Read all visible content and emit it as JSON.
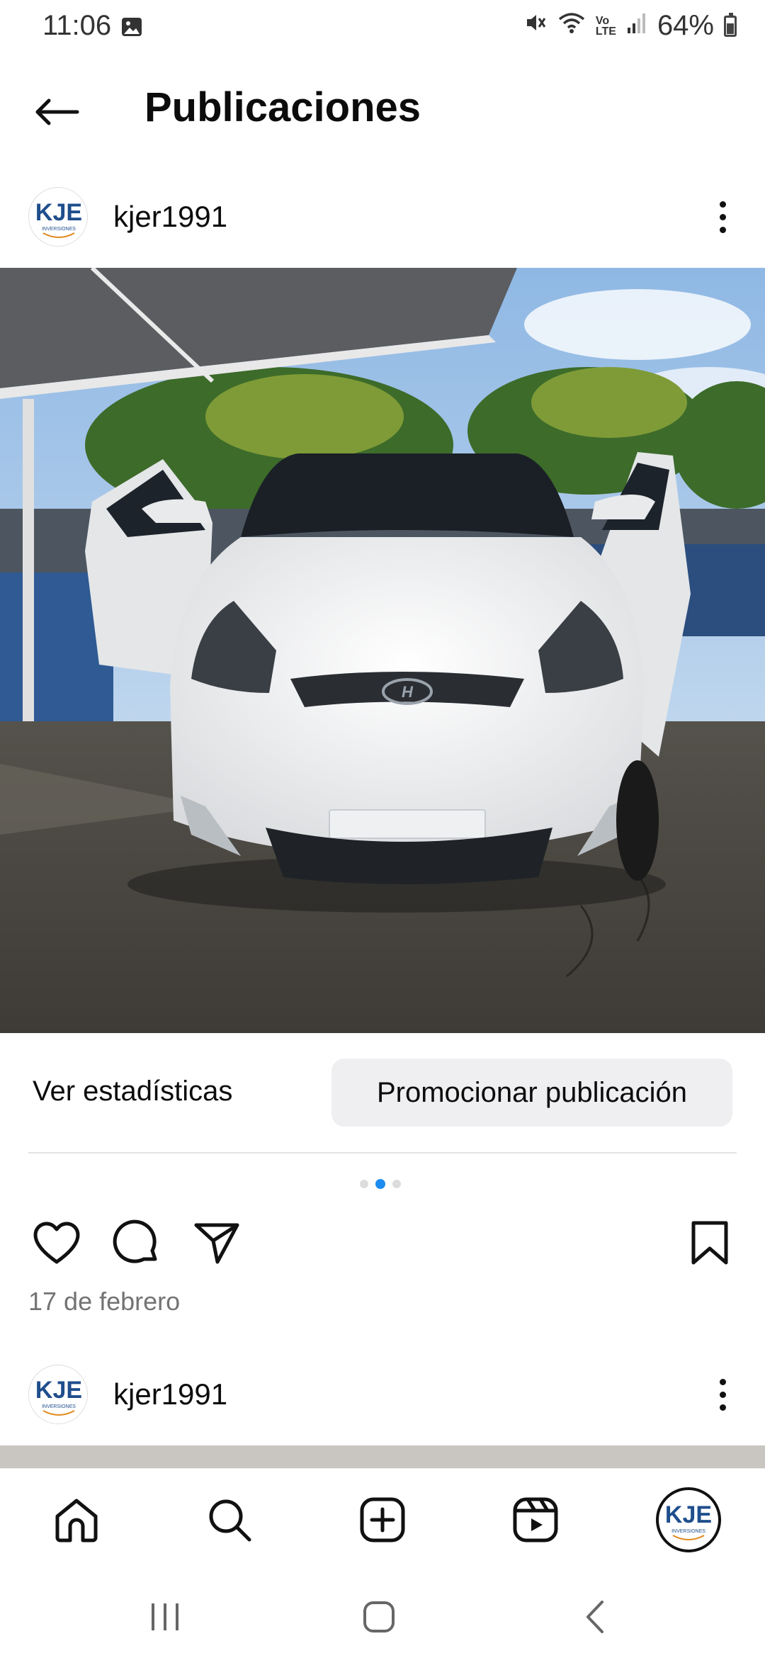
{
  "status_bar": {
    "time": "11:06",
    "battery": "64%",
    "icons": [
      "gallery-icon",
      "mute-icon",
      "wifi-icon",
      "volte-icon",
      "signal-icon",
      "battery-icon"
    ]
  },
  "header": {
    "title": "Publicaciones",
    "back_icon": "arrow-left-icon"
  },
  "post": {
    "username": "kjer1991",
    "avatar_text": "KJE",
    "avatar_subtext": "INVERSIONES",
    "stats_label": "Ver estadísticas",
    "promote_label": "Promocionar publicación",
    "carousel": {
      "count": 3,
      "active_index": 1
    },
    "date": "17 de febrero",
    "actions": [
      "heart-icon",
      "comment-icon",
      "share-icon",
      "bookmark-icon"
    ]
  },
  "next_post": {
    "username": "kjer1991"
  },
  "bottom_nav": {
    "items": [
      "home-icon",
      "search-icon",
      "create-icon",
      "reels-icon",
      "profile-avatar"
    ]
  },
  "colors": {
    "accent": "#1d8cf0",
    "promote_bg": "#efeff1",
    "muted_text": "#737373",
    "logo_blue": "#1f4e8c"
  }
}
